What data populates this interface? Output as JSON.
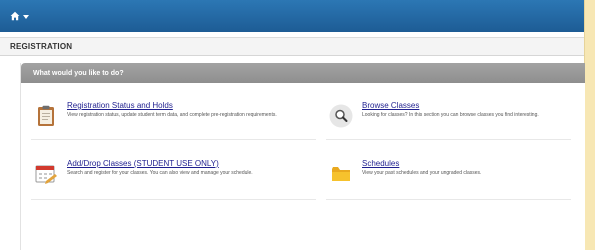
{
  "header": {
    "title": "REGISTRATION"
  },
  "panel": {
    "heading": "What would you like to do?"
  },
  "items": [
    {
      "title": "Registration Status and Holds",
      "description": "View registration status, update student term data, and complete pre-registration requirements.",
      "icon": "clipboard-icon"
    },
    {
      "title": "Browse Classes",
      "description": "Looking for classes? In this section you can browse classes you find interesting.",
      "icon": "magnifier-icon"
    },
    {
      "title": "Add/Drop Classes (STUDENT USE ONLY)",
      "description": "Search and register for your classes. You can also view and manage your schedule.",
      "icon": "calendar-icon"
    },
    {
      "title": "Schedules",
      "description": "View your past schedules and your ungraded classes.",
      "icon": "folder-icon"
    }
  ],
  "colors": {
    "topbar": "#1f5f98",
    "panel_header": "#999999",
    "link": "#1f1f8f",
    "page_background": "#f7e7b4"
  }
}
